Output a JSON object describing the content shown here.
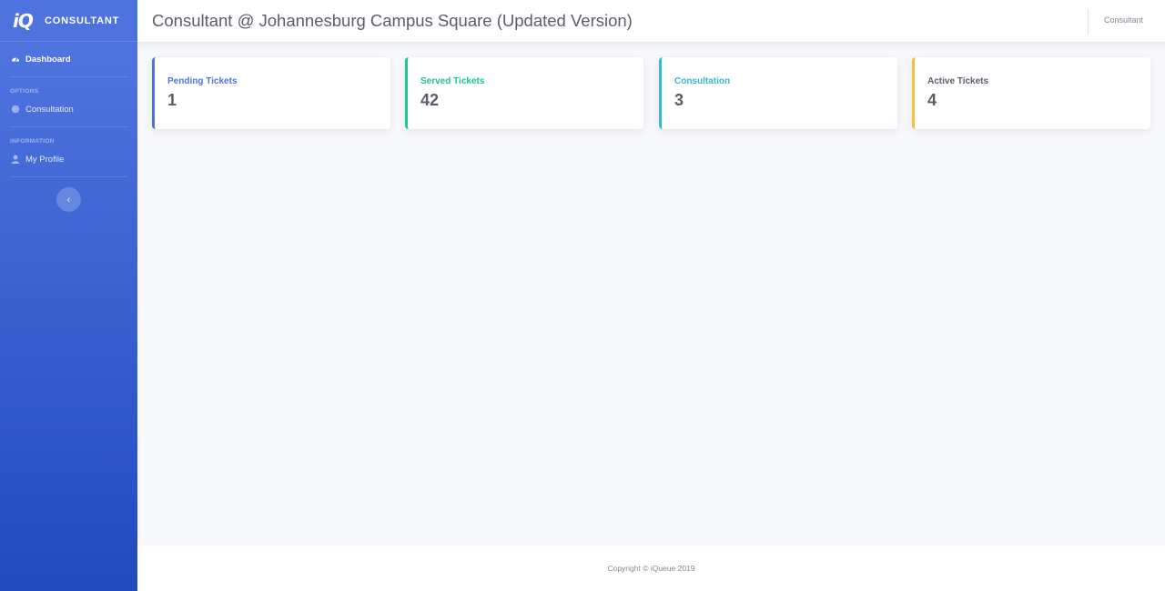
{
  "sidebar": {
    "logo": "iQ",
    "brand": "CONSULTANT",
    "dashboard": "Dashboard",
    "options_heading": "OPTIONS",
    "consultation": "Consultation",
    "information_heading": "INFORMATION",
    "profile": "My Profile",
    "toggle_icon": "chevron-left-icon",
    "toggle_glyph": "‹"
  },
  "topbar": {
    "title": "Consultant @ Johannesburg Campus Square (Updated Version)",
    "user": "Consultant"
  },
  "cards": [
    {
      "label": "Pending Tickets",
      "value": "1",
      "color": "#4e73df"
    },
    {
      "label": "Served Tickets",
      "value": "42",
      "color": "#1cc88a"
    },
    {
      "label": "Consultation",
      "value": "3",
      "color": "#36b9cc"
    },
    {
      "label": "Active Tickets",
      "value": "4",
      "color": "#f6c23e"
    }
  ],
  "footer": {
    "text": "Copyright © iQueue 2019"
  },
  "colors": {
    "sidebar_start": "#4e73df",
    "sidebar_end": "#224abe",
    "background": "#f7f8fc"
  }
}
